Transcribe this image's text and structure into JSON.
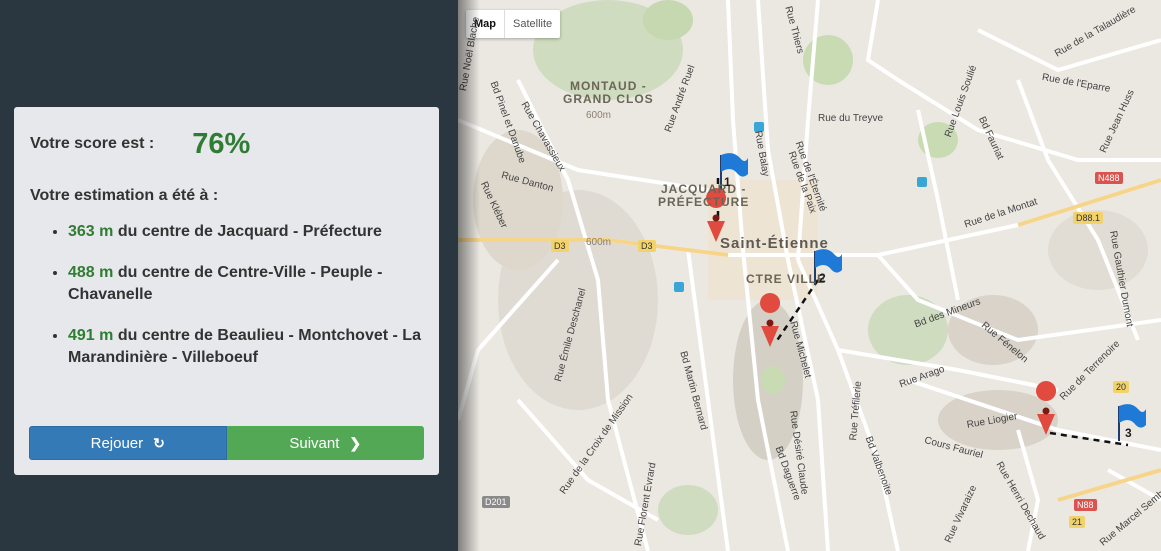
{
  "score": {
    "label": "Votre score est :",
    "value": "76%"
  },
  "estimate_title": "Votre estimation a été à :",
  "results": [
    {
      "distance": "363 m",
      "text": " du centre de Jacquard - Préfecture"
    },
    {
      "distance": "488 m",
      "text": " du centre de Centre-Ville - Peuple - Chavanelle"
    },
    {
      "distance": "491 m",
      "text": " du centre de Beaulieu - Montchovet - La Marandinière - Villeboeuf"
    }
  ],
  "buttons": {
    "replay": "Rejouer",
    "next": "Suivant"
  },
  "map": {
    "type_map": "Map",
    "type_satellite": "Satellite",
    "labels": {
      "montaud": "MONTAUD -",
      "grand_clos": "GRAND CLOS",
      "jacquard": "JACQUARD -",
      "prefecture": "PRÉFECTURE",
      "city": "Saint-Étienne",
      "ctre_ville": "CTRE VILLE",
      "r1": "Rue Noël Blache",
      "r2": "Bd Pinel et Danube",
      "r3": "Rue Chavassieux",
      "r4": "Rue Danton",
      "r5": "Rue Kléber",
      "r6": "Rue Émile Deschanel",
      "r7": "Bd Martin Bernard",
      "r8": "Rue de la Croix de Mission",
      "r9": "Rue Florent Evrard",
      "r10": "Rue Michelet",
      "r11": "Rue Désiré Claude",
      "r12": "Bd Daguerre",
      "r13": "Rue Tréfilerie",
      "r14": "Bd Valbenoite",
      "r15": "Rue Arago",
      "r16": "Cours Fauriel",
      "r17": "Rue Liogier",
      "r18": "Rue de Terrenoire",
      "r19": "Bd des Mineurs",
      "r20": "Rue Fénelon",
      "r21": "Rue de la Montat",
      "r22": "Rue de l'Eparre",
      "r23": "Rue de la Talaudière",
      "r24": "Bd Fauriat",
      "r25": "Rue Louis Soulié",
      "r26": "Rue du Treyve",
      "r27": "Rue Balay",
      "r28": "Rue de l'Éternité",
      "r29": "Rue de la Paix",
      "r30": "Rue André Ruel",
      "r31": "Rue Jean Huss",
      "r32": "Rue Gauthier Dumont",
      "r33": "Rue Henri Dechaud",
      "r34": "Rue Marcel Sembat",
      "r35": "Rue Vivaraize",
      "r36": "Rue Thiers",
      "alt1": "600m",
      "alt2": "600m"
    },
    "shields": {
      "d3a": "D3",
      "d3b": "D3",
      "n488": "N488",
      "d881": "D88.1",
      "d201": "D201",
      "n88": "N88",
      "n20": "20",
      "n21": "21"
    },
    "markers": {
      "flag1": "1",
      "flag2": "2",
      "flag3": "3"
    }
  },
  "colors": {
    "score_green": "#2f7d32",
    "replay_blue": "#337ab7",
    "next_green": "#53a856",
    "sidebar_bg": "#2b3740",
    "panel_bg": "#e6e8eb",
    "pin_red": "#e04a3f",
    "flag_blue": "#1e7ad6"
  },
  "icons": {
    "replay": "refresh-icon",
    "next": "chevron-right-icon"
  }
}
